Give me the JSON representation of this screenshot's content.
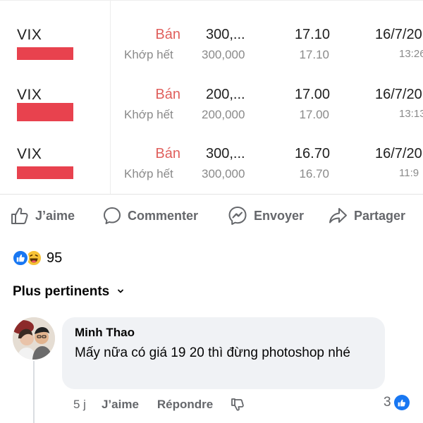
{
  "trades": [
    {
      "symbol": "VIX",
      "side": "Bán",
      "status": "Khớp hết",
      "qty": "300,...",
      "qty_filled": "300,000",
      "price": "17.10",
      "price_filled": "17.10",
      "date": "16/7/20",
      "time": "13:26"
    },
    {
      "symbol": "VIX",
      "side": "Bán",
      "status": "Khớp hết",
      "qty": "200,...",
      "qty_filled": "200,000",
      "price": "17.00",
      "price_filled": "17.00",
      "date": "16/7/20",
      "time": "13:13"
    },
    {
      "symbol": "VIX",
      "side": "Bán",
      "status": "Khớp hết",
      "qty": "300,...",
      "qty_filled": "300,000",
      "price": "16.70",
      "price_filled": "16.70",
      "date": "16/7/20",
      "time": "11:9"
    }
  ],
  "actions": {
    "like": "J’aime",
    "comment": "Commenter",
    "send": "Envoyer",
    "share": "Partager"
  },
  "reactions": {
    "count": "95",
    "icons": [
      "like-icon",
      "haha-icon"
    ]
  },
  "sort": {
    "label": "Plus pertinents",
    "icon": "chevron-down-icon"
  },
  "comment": {
    "author": "Minh Thao",
    "text": "Mấy nữa có giá 19 20 thì đừng photoshop nhé",
    "age": "5 j",
    "like_label": "J’aime",
    "reply_label": "Répondre",
    "reaction_count": "3"
  },
  "colors": {
    "accent": "#1877f2",
    "sell": "#e0605d",
    "redaction": "#e8424e",
    "meta_text": "#65676b",
    "bubble_bg": "#f0f2f5"
  }
}
